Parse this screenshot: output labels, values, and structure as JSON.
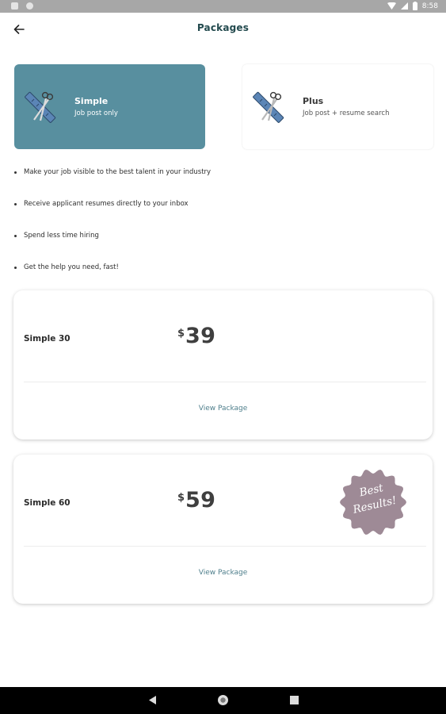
{
  "status_bar": {
    "time": "8:58"
  },
  "header": {
    "title": "Packages"
  },
  "package_tabs": [
    {
      "name": "Simple",
      "description": "Job post only",
      "selected": true
    },
    {
      "name": "Plus",
      "description": "Job post + resume search",
      "selected": false
    }
  ],
  "benefits": [
    "Make your job visible to the best talent in your industry",
    "Receive applicant resumes directly to your inbox",
    "Spend less time hiring",
    "Get the help you need, fast!"
  ],
  "pricing": [
    {
      "name": "Simple 30",
      "currency": "$",
      "amount": "39",
      "link": "View Package"
    },
    {
      "name": "Simple 60",
      "currency": "$",
      "amount": "59",
      "link": "View Package",
      "badge": {
        "line1": "Best",
        "line2": "Results!"
      }
    }
  ],
  "colors": {
    "accent": "#588f9f",
    "title": "#234a4e",
    "link": "#4f7f8c",
    "badge": "#9e8a96"
  },
  "icons": {
    "back": "arrow-left-icon",
    "package": "scissors-ruler-icon",
    "nav": [
      "back-triangle-icon",
      "home-circle-icon",
      "recents-square-icon"
    ]
  }
}
